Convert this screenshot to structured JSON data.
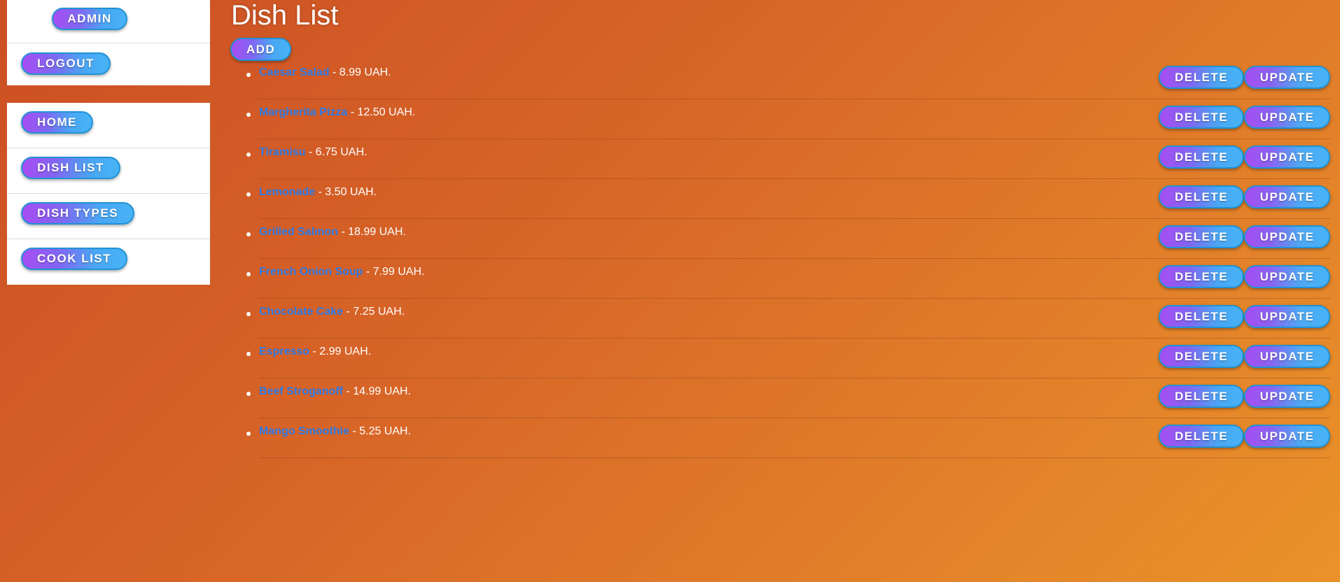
{
  "sidebar": {
    "admin_label": "ADMIN",
    "logout_label": "LOGOUT",
    "nav": [
      {
        "label": "HOME"
      },
      {
        "label": "DISH LIST"
      },
      {
        "label": "DISH TYPES"
      },
      {
        "label": "COOK LIST"
      }
    ]
  },
  "main": {
    "title": "Dish List",
    "add_label": "ADD",
    "delete_label": "DELETE",
    "update_label": "UPDATE",
    "dishes": [
      {
        "name": "Caesar Salad",
        "price": " - 8.99 UAH."
      },
      {
        "name": "Margherita Pizza",
        "price": " - 12.50 UAH."
      },
      {
        "name": "Tiramisu",
        "price": " - 6.75 UAH."
      },
      {
        "name": "Lemonade",
        "price": " - 3.50 UAH."
      },
      {
        "name": "Grilled Salmon",
        "price": " - 18.99 UAH."
      },
      {
        "name": "French Onion Soup",
        "price": " - 7.99 UAH."
      },
      {
        "name": "Chocolate Cake",
        "price": " - 7.25 UAH."
      },
      {
        "name": "Espresso",
        "price": " - 2.99 UAH."
      },
      {
        "name": "Beef Stroganoff",
        "price": " - 14.99 UAH."
      },
      {
        "name": "Mango Smoothie",
        "price": " - 5.25 UAH."
      }
    ]
  },
  "colors": {
    "link": "#2a7ae8",
    "button_gradient_start": "#a74df2",
    "button_gradient_end": "#47b3f6",
    "button_border": "#1f93d6",
    "background_start": "#cc4f24",
    "background_end": "#ea9229"
  }
}
